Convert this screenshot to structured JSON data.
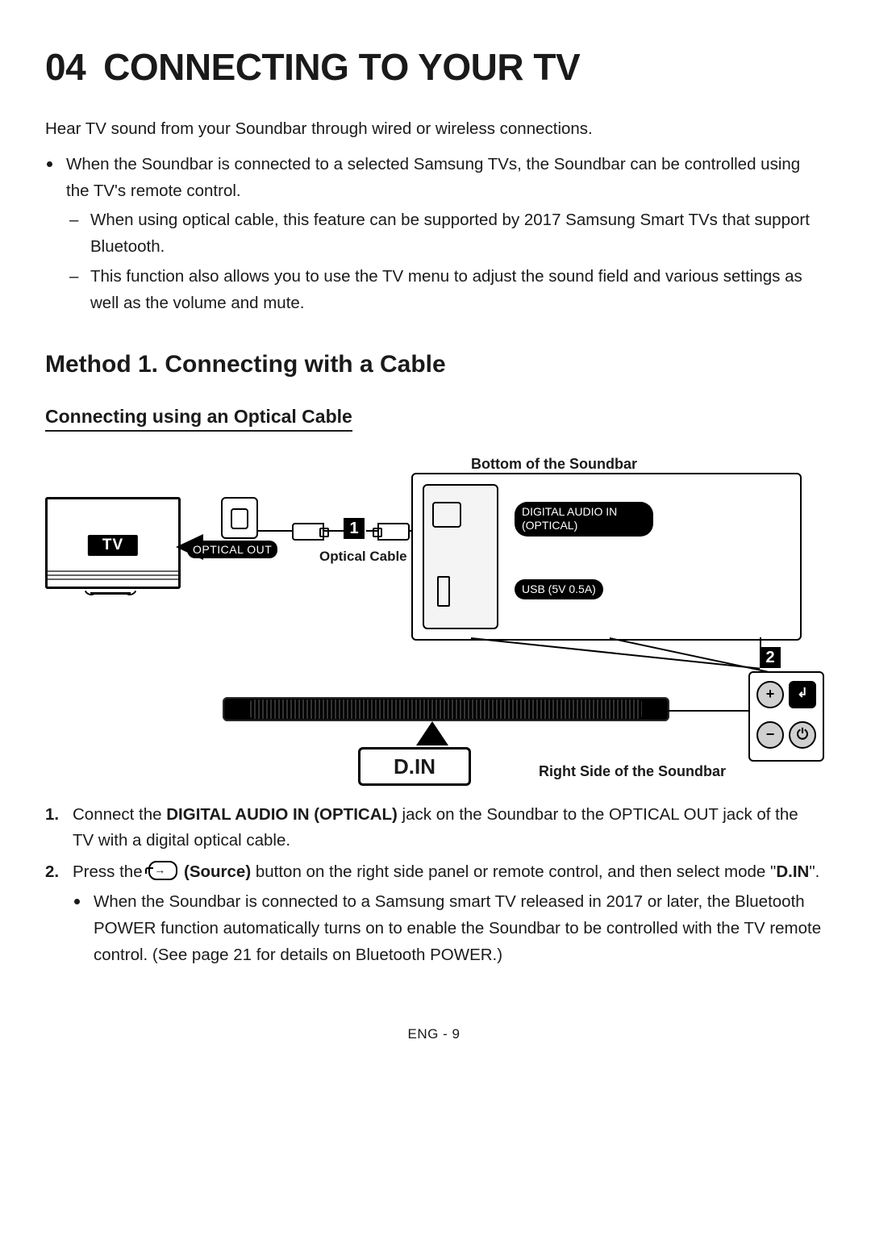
{
  "title_num": "04",
  "title_text": "CONNECTING TO YOUR TV",
  "intro": "Hear TV sound from your Soundbar through wired or wireless connections.",
  "bullet1": "When the Soundbar is connected to a selected Samsung TVs, the Soundbar can be controlled using the TV's remote control.",
  "dash1": "When using optical cable, this feature can be supported by 2017 Samsung Smart TVs that support Bluetooth.",
  "dash2": "This function also allows you to use the TV menu to adjust the sound field and various settings as well as the volume and mute.",
  "method_title": "Method 1. Connecting with a Cable",
  "sub_title": "Connecting using an Optical Cable",
  "diagram": {
    "top_caption": "Bottom of the Soundbar",
    "tv_label": "TV",
    "optical_out": "OPTICAL OUT",
    "optical_cable": "Optical Cable",
    "callout_1": "1",
    "dai_line1": "DIGITAL AUDIO IN",
    "dai_line2": "(OPTICAL)",
    "usb_label": "USB (5V 0.5A)",
    "callout_2": "2",
    "din": "D.IN",
    "right_caption": "Right Side of the Soundbar",
    "btn_plus": "+",
    "btn_minus": "−",
    "btn_source": "↲",
    "btn_power": "⏻"
  },
  "step1_pre": "Connect the ",
  "step1_bold": "DIGITAL AUDIO IN (OPTICAL)",
  "step1_post": " jack on the Soundbar to the OPTICAL OUT jack of the TV with a digital optical cable.",
  "step2_pre": "Press the ",
  "step2_bold": " (Source)",
  "step2_mid": " button on the right side panel or remote control, and then select mode \"",
  "step2_din": "D.IN",
  "step2_post": "\".",
  "step2_sub": "When the Soundbar is connected to a Samsung smart TV released in 2017 or later, the Bluetooth POWER function automatically turns on to enable the Soundbar to be controlled with the TV remote control. (See page 21 for details on Bluetooth POWER.)",
  "footer": "ENG - 9"
}
